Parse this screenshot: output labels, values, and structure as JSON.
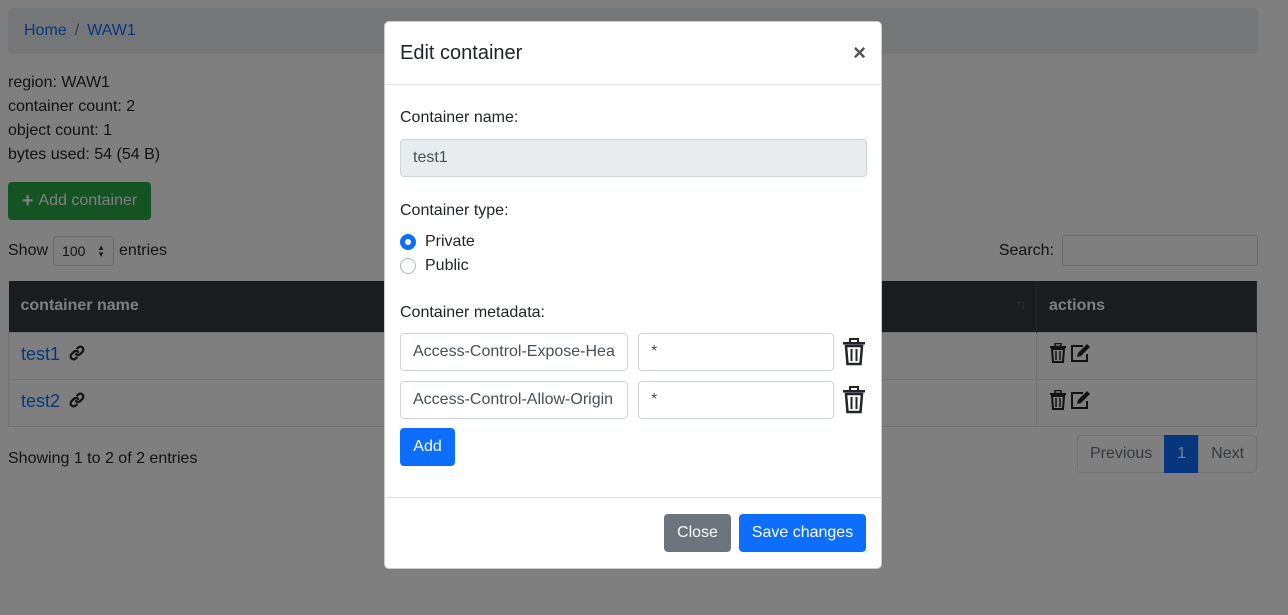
{
  "breadcrumb": {
    "home": "Home",
    "separator": "/",
    "current": "WAW1"
  },
  "info": {
    "region": "region: WAW1",
    "container_count": "container count: 2",
    "object_count": "object count: 1",
    "bytes_used": "bytes used: 54 (54 B)"
  },
  "toolbar": {
    "add_label": "Add container"
  },
  "table_controls": {
    "show_label": "Show",
    "entries_value": "100",
    "entries_label": "entries",
    "search_label": "Search:"
  },
  "table": {
    "headers": {
      "name": "container name",
      "actions": "actions",
      "sort_indicator": "↑↓"
    },
    "rows": [
      {
        "name": "test1"
      },
      {
        "name": "test2"
      }
    ]
  },
  "footer": {
    "showing": "Showing 1 to 2 of 2 entries",
    "prev": "Previous",
    "page": "1",
    "next": "Next"
  },
  "modal": {
    "title": "Edit container",
    "close_glyph": "×",
    "name_label": "Container name:",
    "name_value": "test1",
    "type_label": "Container type:",
    "types": [
      {
        "label": "Private",
        "selected": true
      },
      {
        "label": "Public",
        "selected": false
      }
    ],
    "metadata_label": "Container metadata:",
    "metadata": [
      {
        "key": "Access-Control-Expose-Headers",
        "value": "*"
      },
      {
        "key": "Access-Control-Allow-Origin",
        "value": "*"
      }
    ],
    "add_label": "Add",
    "close_label": "Close",
    "save_label": "Save changes"
  },
  "colors": {
    "primary": "#0d6efd",
    "success": "#28a745",
    "secondary": "#6c757d",
    "table_header": "#343a40"
  },
  "icons": [
    "plus-icon",
    "link-icon",
    "trash-icon",
    "edit-icon",
    "close-icon"
  ]
}
